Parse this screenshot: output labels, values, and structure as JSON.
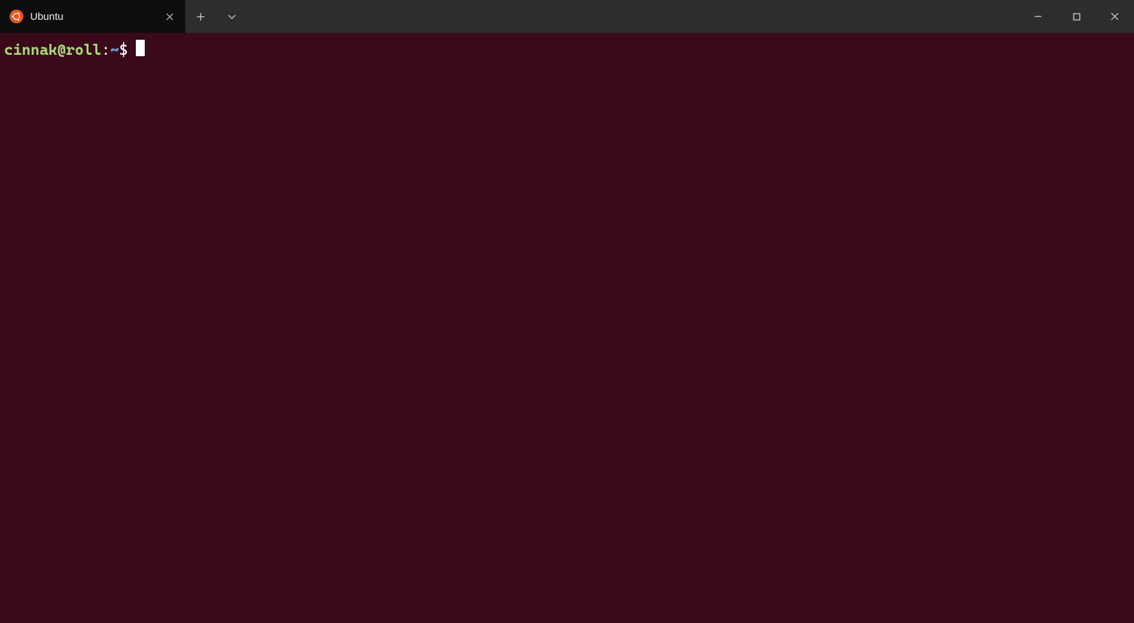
{
  "titlebar": {
    "tab": {
      "label": "Ubuntu",
      "icon_name": "ubuntu-logo-icon"
    }
  },
  "window_controls": {
    "minimize_label": "Minimize",
    "maximize_label": "Maximize",
    "close_label": "Close"
  },
  "terminal": {
    "prompt": {
      "user_host": "cinnak@roll",
      "separator": ":",
      "path": "~",
      "symbol": "$"
    }
  },
  "colors": {
    "terminal_bg": "#3a0a1a",
    "titlebar_bg": "#2d2d2d",
    "tab_bg": "#0d0d0d",
    "prompt_userhost": "#a8d67a",
    "prompt_path": "#6e9cc7",
    "cursor": "#ffffff"
  }
}
